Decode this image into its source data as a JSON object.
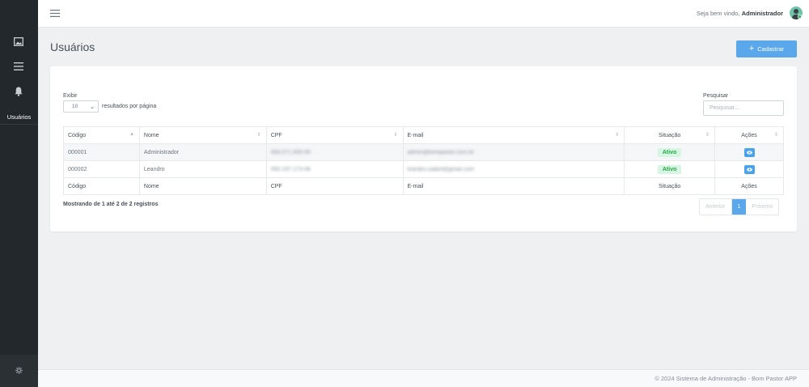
{
  "sidebar": {
    "items": [
      {
        "icon": "image-icon"
      },
      {
        "icon": "menu-icon"
      },
      {
        "icon": "bell-icon"
      },
      {
        "label": "Usuários"
      }
    ],
    "settings_icon": "gear-icon"
  },
  "topbar": {
    "welcome_prefix": "Seja bem vindo, ",
    "username": "Administrador"
  },
  "header": {
    "title": "Usuários",
    "add_button": "Cadastrar"
  },
  "table_controls": {
    "show_label": "Exibir",
    "page_length": "10",
    "per_page_label": "resultados por página",
    "search_label": "Pesquisar",
    "search_placeholder": "Pesquisar..."
  },
  "table": {
    "columns": [
      "Código",
      "Nome",
      "CPF",
      "E-mail",
      "Situação",
      "Ações"
    ],
    "rows": [
      {
        "codigo": "000001",
        "nome": "Administrador",
        "cpf": "000.071.930-00",
        "email": "admin@bompastor.com.br",
        "situacao": "Ativo"
      },
      {
        "codigo": "000002",
        "nome": "Leandro",
        "cpf": "000.197.173-08",
        "email": "leandro.isabel@gmail.com",
        "situacao": "Ativo"
      }
    ],
    "footer": [
      "Código",
      "Nome",
      "CPF",
      "E-mail",
      "Situação",
      "Ações"
    ]
  },
  "info": "Mostrando de 1 até 2 de 2 registros",
  "pagination": {
    "prev": "Anterior",
    "current": "1",
    "next": "Próximo"
  },
  "footer": {
    "copyright": "© 2024 Sistema de Administração - Bom Pastor APP"
  },
  "colors": {
    "sidebar_bg": "#23282d",
    "primary": "#5aa7ec",
    "success": "#28a745"
  }
}
